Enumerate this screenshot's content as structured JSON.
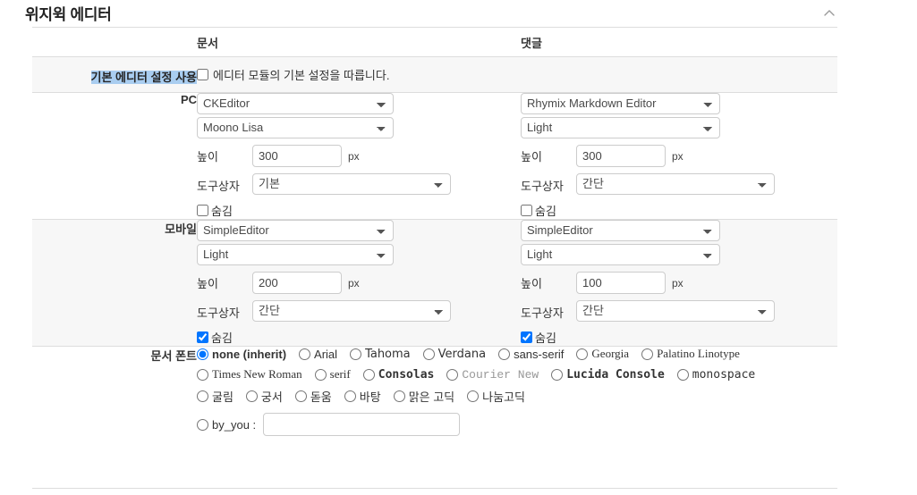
{
  "section": {
    "title": "위지윅 에디터",
    "collapse_icon": "chevron-up-icon"
  },
  "columns": {
    "label": "",
    "document": "문서",
    "comment": "댓글"
  },
  "rows": {
    "default_settings": {
      "label": "기본 에디터 설정 사용",
      "label_highlighted": true,
      "checkbox_label": "에디터 모듈의 기본 설정을 따릅니다.",
      "checked": false
    },
    "pc": {
      "label": "PC",
      "document": {
        "editor": "CKEditor",
        "skin": "Moono Lisa",
        "height_label": "높이",
        "height_value": "300",
        "height_unit": "px",
        "toolbar_label": "도구상자",
        "toolbar_value": "기본",
        "hide_label": "숨김",
        "hide_checked": false
      },
      "comment": {
        "editor": "Rhymix Markdown Editor",
        "skin": "Light",
        "height_label": "높이",
        "height_value": "300",
        "height_unit": "px",
        "toolbar_label": "도구상자",
        "toolbar_value": "간단",
        "hide_label": "숨김",
        "hide_checked": false
      }
    },
    "mobile": {
      "label": "모바일",
      "document": {
        "editor": "SimpleEditor",
        "skin": "Light",
        "height_label": "높이",
        "height_value": "200",
        "height_unit": "px",
        "toolbar_label": "도구상자",
        "toolbar_value": "간단",
        "hide_label": "숨김",
        "hide_checked": true
      },
      "comment": {
        "editor": "SimpleEditor",
        "skin": "Light",
        "height_label": "높이",
        "height_value": "100",
        "height_unit": "px",
        "toolbar_label": "도구상자",
        "toolbar_value": "간단",
        "hide_label": "숨김",
        "hide_checked": true
      }
    },
    "document_font": {
      "label": "문서 폰트",
      "selected": "none (inherit)",
      "lines": [
        [
          {
            "label": "none (inherit)",
            "style": "f-default",
            "checked": true
          },
          {
            "label": "Arial",
            "style": "f-arial",
            "checked": false
          },
          {
            "label": "Tahoma",
            "style": "f-tahoma",
            "checked": false
          },
          {
            "label": "Verdana",
            "style": "f-verdana",
            "checked": false
          },
          {
            "label": "sans-serif",
            "style": "f-sans",
            "checked": false
          },
          {
            "label": "Georgia",
            "style": "f-georgia",
            "checked": false
          },
          {
            "label": "Palatino Linotype",
            "style": "f-palatino",
            "checked": false
          }
        ],
        [
          {
            "label": "Times New Roman",
            "style": "f-times",
            "checked": false
          },
          {
            "label": "serif",
            "style": "f-serif",
            "checked": false
          },
          {
            "label": "Consolas",
            "style": "f-consolas",
            "checked": false
          },
          {
            "label": "Courier New",
            "style": "f-courier",
            "checked": false
          },
          {
            "label": "Lucida Console",
            "style": "f-lucida",
            "checked": false
          },
          {
            "label": "monospace",
            "style": "f-mono",
            "checked": false
          }
        ],
        [
          {
            "label": "굴림",
            "style": "f-ko",
            "checked": false
          },
          {
            "label": "궁서",
            "style": "f-ko",
            "checked": false
          },
          {
            "label": "돋움",
            "style": "f-ko",
            "checked": false
          },
          {
            "label": "바탕",
            "style": "f-ko",
            "checked": false
          },
          {
            "label": "맑은 고딕",
            "style": "f-ko",
            "checked": false
          },
          {
            "label": "나눔고딕",
            "style": "f-ko",
            "checked": false
          }
        ]
      ],
      "custom": {
        "label": "by_you :",
        "checked": false,
        "value": "",
        "placeholder": ""
      }
    }
  },
  "colors": {
    "row_alt_bg": "#f7f7f7",
    "border": "#dddddd",
    "selection_highlight": "#a9cdf0",
    "text": "#333333",
    "control_border": "#cccccc"
  }
}
